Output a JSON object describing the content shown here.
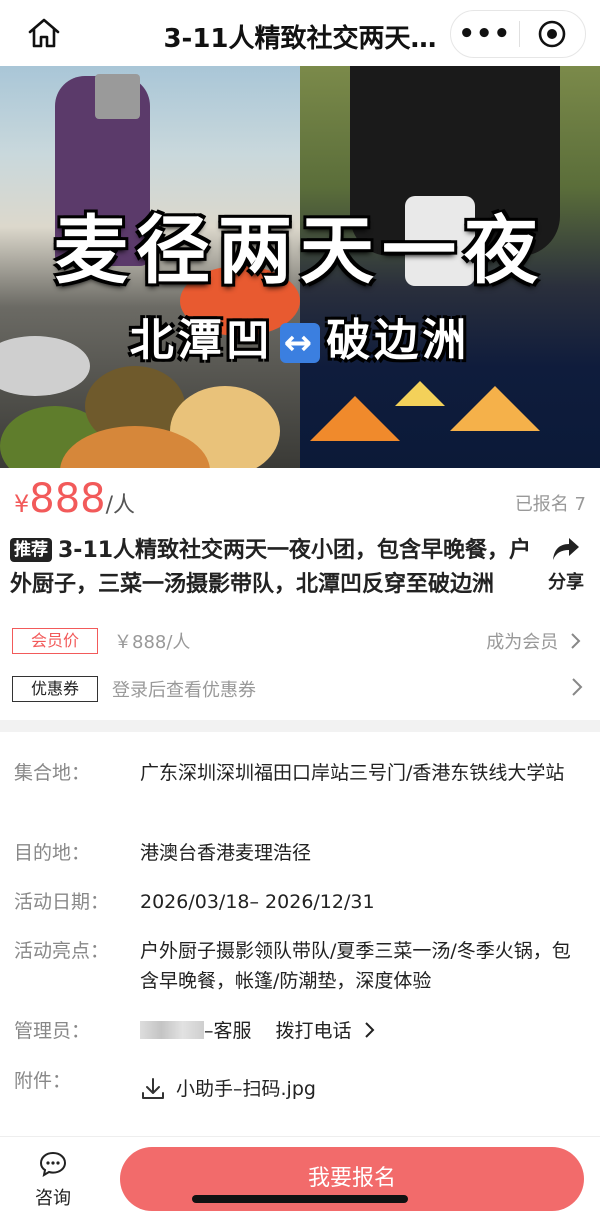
{
  "navbar": {
    "title": "3-11人精致社交两天…",
    "more_glyph": "•••"
  },
  "banner": {
    "title": "麦径两天一夜",
    "sub_left": "北潭凹",
    "sub_arrow": "↔",
    "sub_right": "破边洲"
  },
  "price": {
    "currency": "¥",
    "amount": "888",
    "unit": "/人",
    "signed_up": "已报名 7"
  },
  "activity": {
    "tag": "推荐",
    "title": "3-11人精致社交两天一夜小团，包含早晚餐，户外厨子，三菜一汤摄影带队，北潭凹反穿至破边洲",
    "share_label": "分享"
  },
  "member": {
    "tag": "会员价",
    "price": "￥888/人",
    "link": "成为会员"
  },
  "coupon": {
    "tag": "优惠券",
    "text": "登录后查看优惠券"
  },
  "info": {
    "meeting_label": "集合地：",
    "meeting_value": "广东深圳深圳福田口岸站三号门/香港东铁线大学站",
    "destination_label": "目的地：",
    "destination_value": "港澳台香港麦理浩径",
    "date_label": "活动日期：",
    "date_value": "2026/03/18– 2026/12/31",
    "highlights_label": "活动亮点：",
    "highlights_value": "户外厨子摄影领队带队/夏季三菜一汤/冬季火锅，包含早晚餐，帐篷/防潮垫，深度体验",
    "admin_label": "管理员：",
    "admin_suffix": "–客服",
    "admin_call": "拨打电话",
    "attachment_label": "附件：",
    "attachment_file": "小助手–扫码.jpg"
  },
  "bottom": {
    "consult_label": "咨询",
    "signup_label": "我要报名"
  },
  "colors": {
    "accent": "#f25a5a",
    "button": "#f26b6b"
  }
}
